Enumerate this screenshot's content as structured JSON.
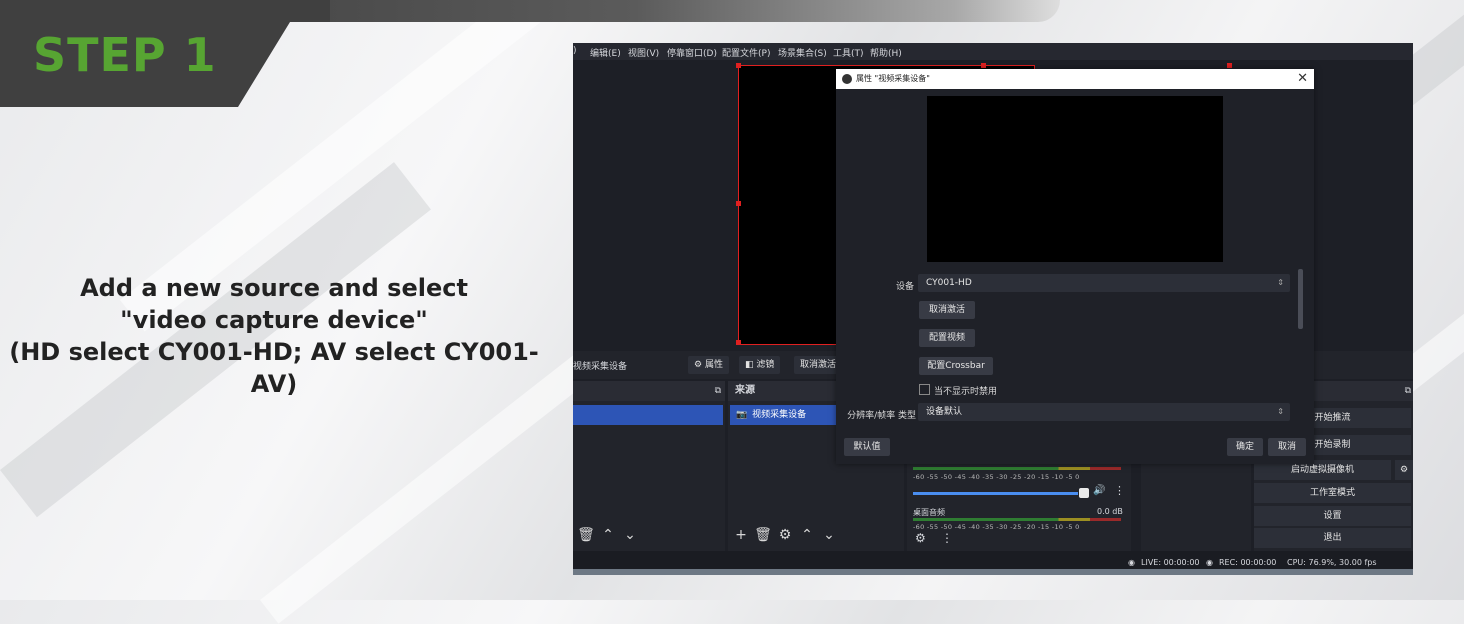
{
  "step": "STEP 1",
  "instructions": [
    "Add a new source and select",
    "\"video capture device\"",
    "(HD select CY001-HD; AV select CY001-AV)"
  ],
  "menu": [
    ")",
    "编辑(E)",
    "视图(V)",
    "停靠窗口(D)",
    "配置文件(P)",
    "场景集合(S)",
    "工具(T)",
    "帮助(H)"
  ],
  "context_bar": {
    "source_name": "视频采集设备",
    "properties_label": "属性",
    "filters_label": "滤镜",
    "deactivate_label": "取消激活"
  },
  "sources_panel": {
    "title": "来源",
    "selected_item": "视频采集设备"
  },
  "mixer": {
    "ticks": "-60 -55 -50 -45 -40 -35 -30 -25 -20 -15 -10 -5 0",
    "desktop_audio_label": "桌面音频",
    "desktop_audio_level": "0.0 dB"
  },
  "controls": {
    "start_streaming": "开始推流",
    "start_recording": "开始录制",
    "virtual_camera": "启动虚拟摄像机",
    "studio_mode": "工作室模式",
    "settings": "设置",
    "exit": "退出"
  },
  "status": {
    "live": "LIVE: 00:00:00",
    "rec": "REC: 00:00:00",
    "cpu": "CPU: 76.9%, 30.00 fps"
  },
  "dialog": {
    "title": "属性 \"视频采集设备\"",
    "device_label": "设备",
    "device_value": "CY001-HD",
    "deactivate_button": "取消激活",
    "configure_video_button": "配置视频",
    "configure_crossbar_button": "配置Crossbar",
    "hide_checkbox_label": "当不显示时禁用",
    "resolution_label": "分辨率/帧率 类型",
    "resolution_value": "设备默认",
    "defaults_button": "默认值",
    "ok_button": "确定",
    "cancel_button": "取消"
  },
  "colors": {
    "step_green": "#57a532",
    "selection_blue": "#2d55b6",
    "preview_border_red": "#e02020"
  }
}
